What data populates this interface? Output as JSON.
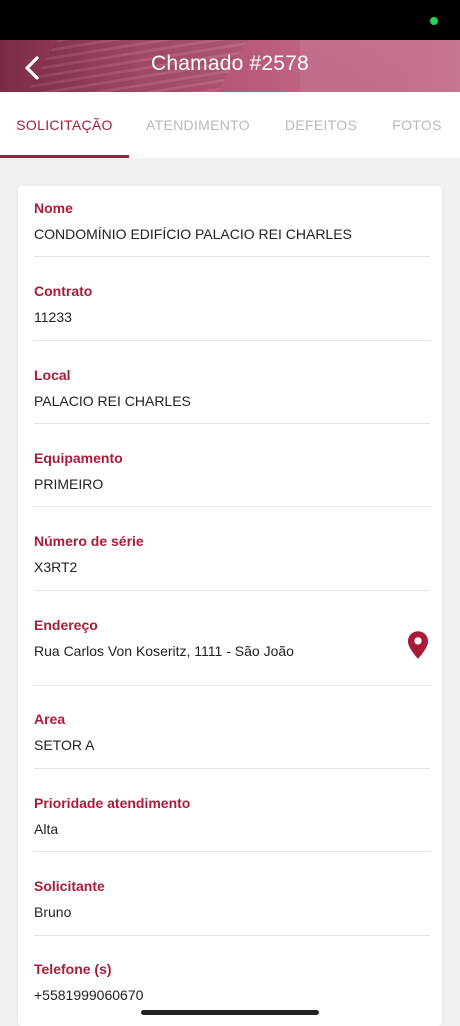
{
  "header": {
    "title": "Chamado #2578",
    "back_icon": "chevron-left-icon"
  },
  "tabs": [
    {
      "label": "SOLICITAÇÃO",
      "active": true
    },
    {
      "label": "ATENDIMENTO",
      "active": false
    },
    {
      "label": "DEFEITOS",
      "active": false
    },
    {
      "label": "FOTOS",
      "active": false
    }
  ],
  "fields": {
    "nome": {
      "label": "Nome",
      "value": "CONDOMÍNIO EDIFÍCIO PALACIO REI CHARLES"
    },
    "contrato": {
      "label": "Contrato",
      "value": "11233"
    },
    "local": {
      "label": "Local",
      "value": "PALACIO REI CHARLES"
    },
    "equipamento": {
      "label": "Equipamento",
      "value": "PRIMEIRO"
    },
    "numero_serie": {
      "label": "Número de série",
      "value": "X3RT2"
    },
    "endereco": {
      "label": "Endereço",
      "value": "Rua Carlos Von Koseritz, 1111 - São João",
      "icon": "map-pin-icon"
    },
    "area": {
      "label": "Area",
      "value": "SETOR A"
    },
    "prioridade": {
      "label": "Prioridade atendimento",
      "value": "Alta"
    },
    "solicitante": {
      "label": "Solicitante",
      "value": "Bruno"
    },
    "telefone": {
      "label": "Telefone (s)",
      "value": "+5581999060670"
    }
  },
  "colors": {
    "accent": "#a81c3a",
    "header_gradient_start": "#7b2b43",
    "header_gradient_end": "#c77593",
    "inactive_tab": "#b9b9b9"
  }
}
